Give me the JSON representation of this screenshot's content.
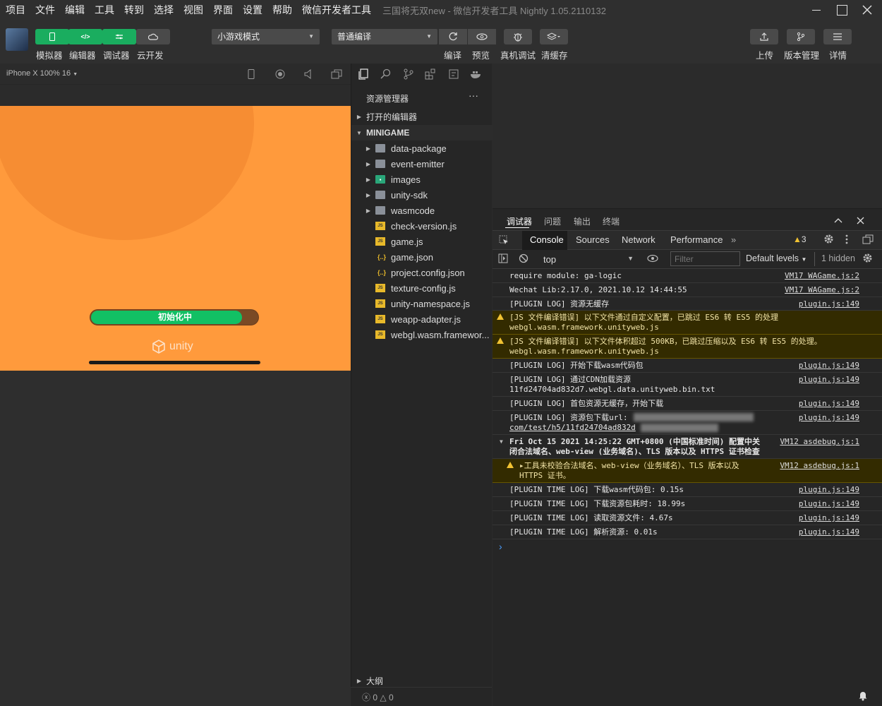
{
  "menubar": {
    "items": [
      "项目",
      "文件",
      "编辑",
      "工具",
      "转到",
      "选择",
      "视图",
      "界面",
      "设置",
      "帮助",
      "微信开发者工具"
    ],
    "title": "三国将无双new - 微信开发者工具 Nightly 1.05.2110132"
  },
  "toolbar": {
    "simulator": "模拟器",
    "editor": "编辑器",
    "debugger": "调试器",
    "cloud": "云开发",
    "mode_select": "小游戏模式",
    "compile_select": "普通编译",
    "compile": "编译",
    "preview": "预览",
    "real_debug": "真机调试",
    "clear_cache": "清缓存",
    "upload": "上传",
    "version": "版本管理",
    "details": "详情"
  },
  "simulator": {
    "device": "iPhone X 100% 16",
    "progress_label": "初始化中",
    "progress_fraction": 0.9,
    "unity_text": "unity"
  },
  "explorer": {
    "title": "资源管理器",
    "more": "···",
    "open_editors": "打开的编辑器",
    "project": "MINIGAME",
    "folders": [
      "data-package",
      "event-emitter",
      "images",
      "unity-sdk",
      "wasmcode"
    ],
    "files": [
      {
        "name": "check-version.js",
        "kind": "js"
      },
      {
        "name": "game.js",
        "kind": "js"
      },
      {
        "name": "game.json",
        "kind": "json"
      },
      {
        "name": "project.config.json",
        "kind": "json"
      },
      {
        "name": "texture-config.js",
        "kind": "js"
      },
      {
        "name": "unity-namespace.js",
        "kind": "js"
      },
      {
        "name": "weapp-adapter.js",
        "kind": "js"
      },
      {
        "name": "webgl.wasm.framewor...",
        "kind": "js"
      }
    ],
    "outline": "大纲",
    "errors": "0",
    "warnings": "0"
  },
  "devtools": {
    "tabs": [
      "调试器",
      "问题",
      "输出",
      "终端"
    ],
    "console_tabs": [
      "Console",
      "Sources",
      "Network",
      "Performance"
    ],
    "more_tabs": "»",
    "warn_count": "3",
    "context": "top",
    "filter_placeholder": "Filter",
    "levels": "Default levels",
    "hidden": "1 hidden",
    "logs": [
      {
        "type": "log",
        "text": "require module: ga-logic",
        "src": "VM17 WAGame.js:2"
      },
      {
        "type": "log",
        "text": "Wechat Lib:2.17.0, 2021.10.12 14:44:55",
        "src": "VM17 WAGame.js:2"
      },
      {
        "type": "log",
        "text": "[PLUGIN LOG] 资源无缓存",
        "src": "plugin.js:149"
      },
      {
        "type": "warn",
        "text": "[JS 文件编译错误] 以下文件通过自定义配置，已跳过 ES6 转 ES5 的处理\nwebgl.wasm.framework.unityweb.js",
        "src": ""
      },
      {
        "type": "warn",
        "text": "[JS 文件编译错误] 以下文件体积超过 500KB，已跳过压缩以及 ES6 转 ES5 的处理。\nwebgl.wasm.framework.unityweb.js",
        "src": ""
      },
      {
        "type": "log",
        "text": "[PLUGIN LOG] 开始下载wasm代码包",
        "src": "plugin.js:149"
      },
      {
        "type": "log",
        "text": "[PLUGIN LOG] 通过CDN加载资源\n11fd24704ad832d7.webgl.data.unityweb.bin.txt",
        "src": "plugin.js:149"
      },
      {
        "type": "log",
        "text": "[PLUGIN LOG] 首包资源无缓存，开始下载",
        "src": "plugin.js:149"
      },
      {
        "type": "log",
        "text": "[PLUGIN LOG] 资源包下载url:",
        "src": "plugin.js:149",
        "line2": "com/test/h5/11fd24704ad832d"
      },
      {
        "type": "group",
        "text": "Fri Oct 15 2021 14:25:22 GMT+0800 (中国标准时间) 配置中关\n闭合法域名、web-view (业务域名)、TLS 版本以及 HTTPS 证书检查",
        "src": "VM12 asdebug.js:1"
      },
      {
        "type": "warn2",
        "text": "▸工具未校验合法域名、web-view（业务域名）、TLS 版本以及\nHTTPS 证书。",
        "src": "VM12 asdebug.js:1"
      },
      {
        "type": "log",
        "text": "[PLUGIN TIME LOG] 下载wasm代码包: 0.15s",
        "src": "plugin.js:149"
      },
      {
        "type": "log",
        "text": "[PLUGIN TIME LOG] 下载资源包耗时: 18.99s",
        "src": "plugin.js:149"
      },
      {
        "type": "log",
        "text": "[PLUGIN TIME LOG] 读取资源文件: 4.67s",
        "src": "plugin.js:149"
      },
      {
        "type": "log",
        "text": "[PLUGIN TIME LOG] 解析资源: 0.01s",
        "src": "plugin.js:149"
      }
    ],
    "prompt": "›"
  }
}
